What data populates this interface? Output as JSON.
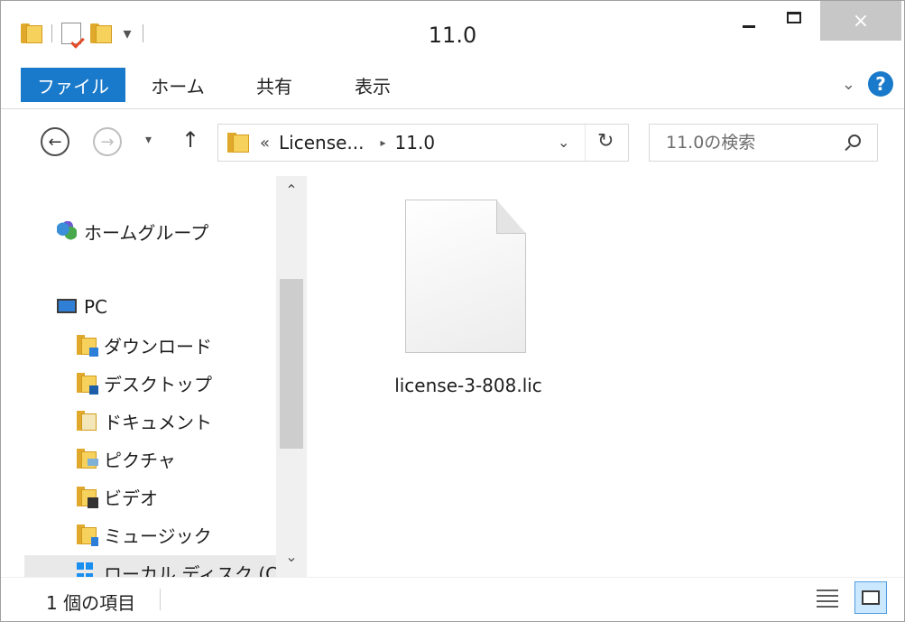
{
  "window": {
    "title": "11.0",
    "controls": {
      "minimize": "minimize",
      "maximize": "maximize",
      "close": "×"
    }
  },
  "ribbon": {
    "tabs": [
      {
        "label": "ファイル",
        "active": true
      },
      {
        "label": "ホーム"
      },
      {
        "label": "共有"
      },
      {
        "label": "表示"
      }
    ],
    "help": "?"
  },
  "nav": {
    "back": "←",
    "forward": "→",
    "recent": "▾",
    "up": "↑",
    "breadcrumbs": [
      "License...",
      "11.0"
    ],
    "overflow": "«",
    "separator": "▸",
    "refresh": "↻",
    "search_placeholder": "11.0の検索"
  },
  "navpane": {
    "items": [
      {
        "label": "ホームグループ",
        "icon": "homegroup-icon"
      },
      {
        "label": "PC",
        "icon": "pc-icon"
      },
      {
        "label": "ダウンロード",
        "icon": "downloads-folder-icon"
      },
      {
        "label": "デスクトップ",
        "icon": "desktop-folder-icon"
      },
      {
        "label": "ドキュメント",
        "icon": "documents-folder-icon"
      },
      {
        "label": "ピクチャ",
        "icon": "pictures-folder-icon"
      },
      {
        "label": "ビデオ",
        "icon": "videos-folder-icon"
      },
      {
        "label": "ミュージック",
        "icon": "music-folder-icon"
      },
      {
        "label": "ローカル ディスク (C",
        "icon": "local-disk-icon"
      }
    ]
  },
  "content": {
    "files": [
      {
        "name": "license-3-808.lic",
        "icon": "blank-file-icon"
      }
    ]
  },
  "status": {
    "item_count": "1 個の項目"
  },
  "colors": {
    "accent": "#1979ca",
    "close_button": "#c7c7c7",
    "selected_view": "#cce8ff"
  }
}
